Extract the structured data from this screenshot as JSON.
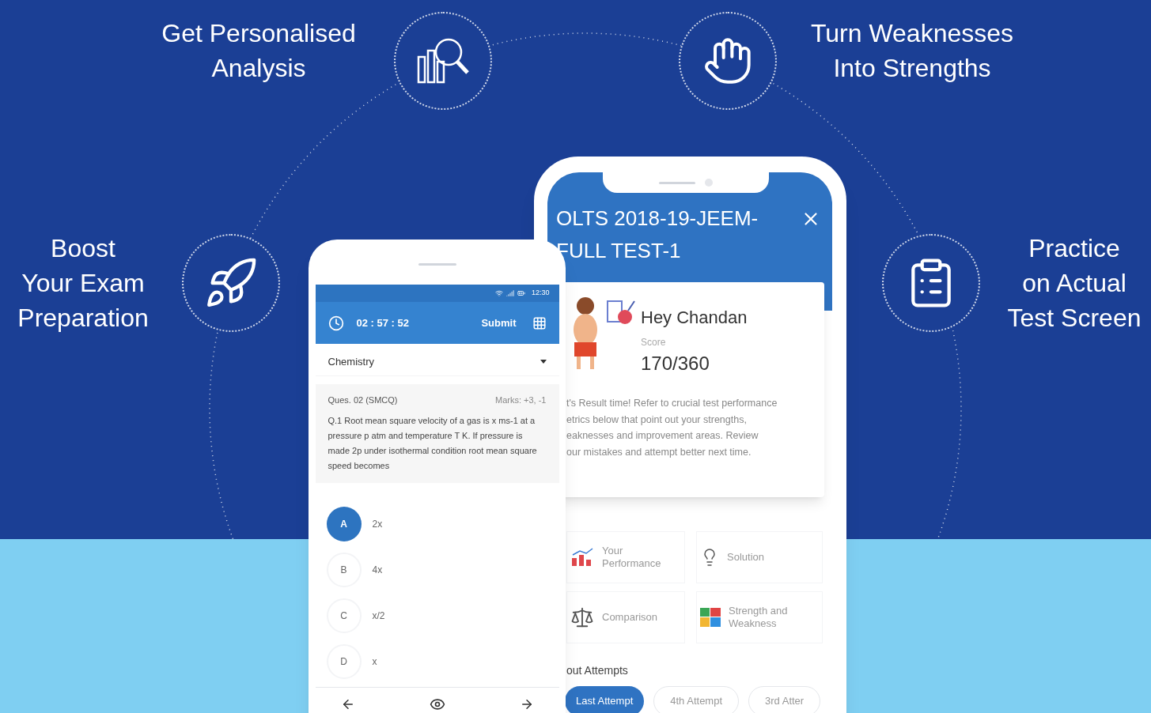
{
  "features": [
    {
      "kind": "analysis",
      "label": "Get Personalised\nAnalysis"
    },
    {
      "kind": "strength",
      "label": "Turn Weaknesses\nInto Strengths"
    },
    {
      "kind": "boost",
      "label": "Boost\nYour Exam\nPreparation"
    },
    {
      "kind": "practice",
      "label": "Practice\non Actual\nTest Screen"
    }
  ],
  "quiz_phone": {
    "status_time": "12:30",
    "timer": "02 : 57 : 52",
    "submit": "Submit",
    "subject": "Chemistry",
    "question_number": "Ques. 02 (SMCQ)",
    "marks": "Marks: +3, -1",
    "question": "Q.1  Root mean square velocity of a gas is x ms-1 at a pressure p atm and temperature T K. If pressure is made 2p under isothermal condition root mean square speed becomes",
    "options": [
      {
        "letter": "A",
        "text": "2x",
        "selected": true
      },
      {
        "letter": "B",
        "text": "4x",
        "selected": false
      },
      {
        "letter": "C",
        "text": "x/2",
        "selected": false
      },
      {
        "letter": "D",
        "text": "x",
        "selected": false
      }
    ]
  },
  "result_phone": {
    "title": "OLTS 2018-19-JEEM-FULL TEST-1",
    "greeting": "Hey Chandan",
    "score_label": "Score",
    "score": "170/360",
    "message_lines": [
      "t's Result time! Refer to crucial test performance",
      "etrics below that point out your strengths,",
      "eaknesses and improvement areas. Review",
      "our mistakes and attempt better next time."
    ],
    "tiles": [
      {
        "kind": "performance",
        "label": "Your\nPerformance"
      },
      {
        "kind": "solution",
        "label": "Solution"
      },
      {
        "kind": "comparison",
        "label": "Comparison"
      },
      {
        "kind": "strength",
        "label": "Strength and\nWeakness"
      }
    ],
    "attempts_heading": "out Attempts",
    "attempts": [
      {
        "label": "Last Attempt",
        "selected": true
      },
      {
        "label": "4th Attempt",
        "selected": false
      },
      {
        "label": "3rd Atter",
        "selected": false
      }
    ]
  }
}
